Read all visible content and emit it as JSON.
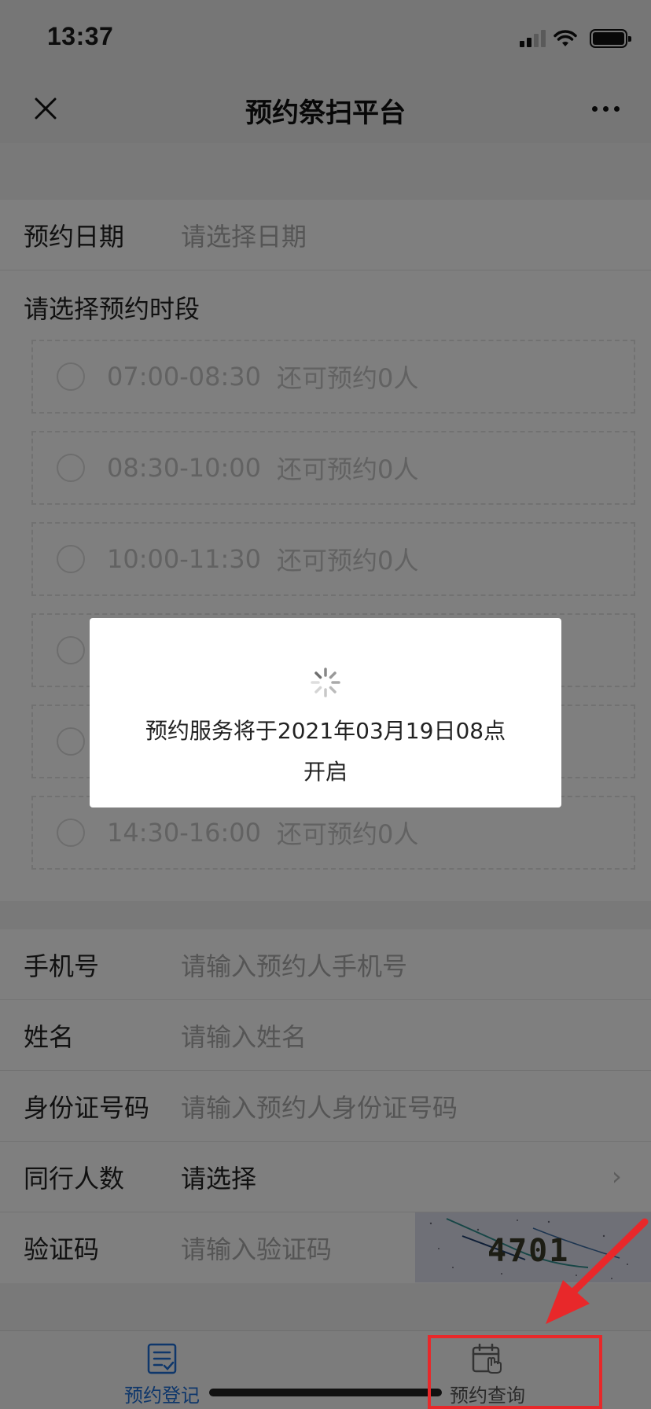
{
  "status": {
    "time": "13:37"
  },
  "nav": {
    "title": "预约祭扫平台"
  },
  "form": {
    "date": {
      "label": "预约日期",
      "placeholder": "请选择日期"
    },
    "slots_heading": "请选择预约时段",
    "slots": [
      {
        "time": "07:00-08:30",
        "remaining": "还可预约0人"
      },
      {
        "time": "08:30-10:00",
        "remaining": "还可预约0人"
      },
      {
        "time": "10:00-11:30",
        "remaining": "还可预约0人"
      },
      {
        "time": "",
        "remaining": ""
      },
      {
        "time": "",
        "remaining": ""
      },
      {
        "time": "14:30-16:00",
        "remaining": "还可预约0人"
      }
    ],
    "phone": {
      "label": "手机号",
      "placeholder": "请输入预约人手机号"
    },
    "name": {
      "label": "姓名",
      "placeholder": "请输入姓名"
    },
    "id_card": {
      "label": "身份证号码",
      "placeholder": "请输入预约人身份证号码"
    },
    "companions": {
      "label": "同行人数",
      "value": "请选择"
    },
    "captcha": {
      "label": "验证码",
      "placeholder": "请输入验证码",
      "image_text": "4701"
    }
  },
  "modal": {
    "line1": "预约服务将于2021年03月19日08点",
    "line2": "开启"
  },
  "tabs": {
    "register": {
      "label": "预约登记",
      "icon": "list-check-icon"
    },
    "query": {
      "label": "预约查询",
      "icon": "calendar-hand-icon"
    }
  },
  "colors": {
    "accent": "#1f6fd6",
    "annotation": "#e8282a",
    "overlay": "rgba(0,0,0,0.5)"
  }
}
